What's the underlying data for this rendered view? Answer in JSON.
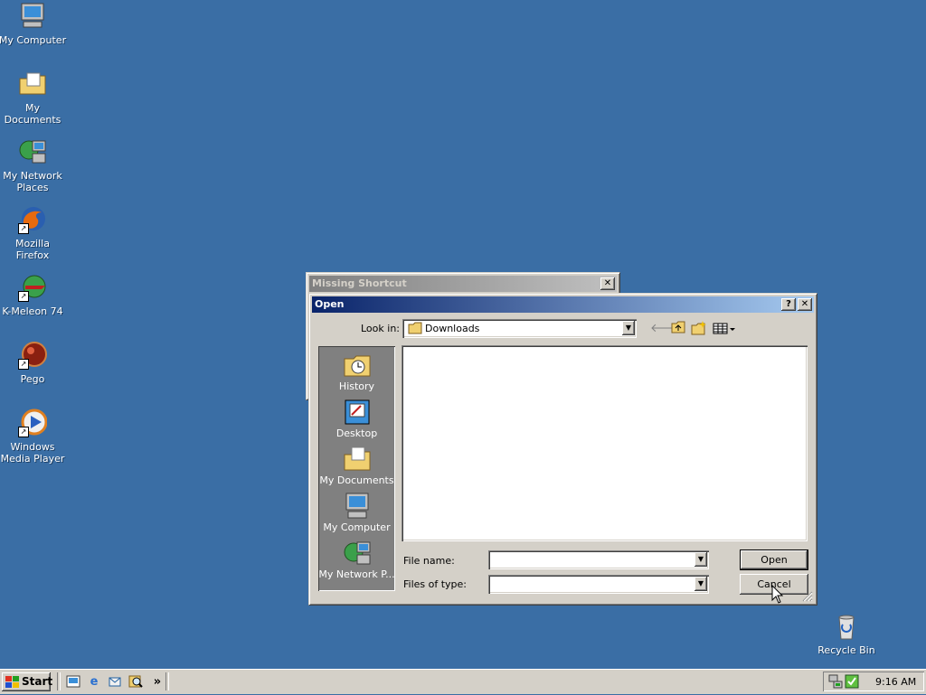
{
  "desktop": {
    "icons": [
      {
        "label": "My Computer",
        "icon": "computer-icon"
      },
      {
        "label": "My Documents",
        "icon": "folder-documents-icon"
      },
      {
        "label": "My Network Places",
        "icon": "network-icon"
      },
      {
        "label": "Mozilla Firefox",
        "icon": "firefox-icon"
      },
      {
        "label": "K-Meleon 74",
        "icon": "kmeleon-icon"
      },
      {
        "label": "Pego",
        "icon": "pego-icon"
      },
      {
        "label": "Windows Media Player",
        "icon": "media-player-icon"
      },
      {
        "label": "Recycle Bin",
        "icon": "recycle-bin-icon"
      }
    ]
  },
  "missing_shortcut": {
    "title": "Missing Shortcut",
    "close": "✕"
  },
  "open_dialog": {
    "title": "Open",
    "help": "?",
    "close": "✕",
    "look_in_label": "Look in:",
    "look_in_value": "Downloads",
    "places": [
      {
        "label": "History",
        "icon": "history-icon"
      },
      {
        "label": "Desktop",
        "icon": "desktop-icon"
      },
      {
        "label": "My Documents",
        "icon": "my-documents-icon"
      },
      {
        "label": "My Computer",
        "icon": "my-computer-icon"
      },
      {
        "label": "My Network P...",
        "icon": "my-network-icon"
      }
    ],
    "file_name_label": "File name:",
    "file_name_value": "",
    "files_of_type_label": "Files of type:",
    "files_of_type_value": "",
    "open_button": "Open",
    "cancel_button": "Cancel"
  },
  "taskbar": {
    "start_label": "Start",
    "quick_launch_more": "»",
    "clock": "9:16 AM"
  }
}
